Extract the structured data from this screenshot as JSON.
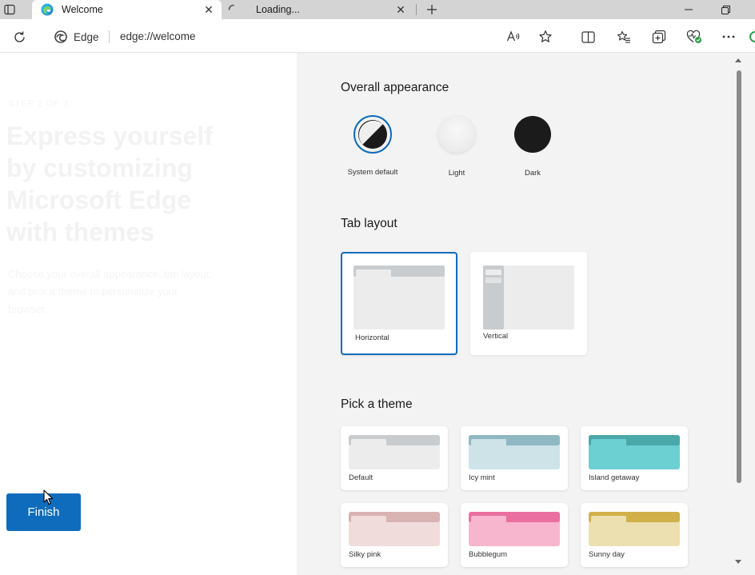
{
  "browser": {
    "tabs": [
      {
        "title": "Welcome",
        "active": true,
        "icon": "edge-logo-icon"
      },
      {
        "title": "Loading...",
        "active": false,
        "icon": "loading-spinner-icon"
      }
    ],
    "address": {
      "site_label": "Edge",
      "url": "edge://welcome"
    }
  },
  "welcome": {
    "kicker": "STEP 2 OF 3",
    "heading": "Express yourself by customizing Microsoft Edge with themes",
    "body": "Choose your overall appearance, tab layout, and pick a theme to personalize your browser.",
    "finish_label": "Finish"
  },
  "settings": {
    "appearance": {
      "title": "Overall appearance",
      "options": [
        {
          "label": "System default",
          "selected": true
        },
        {
          "label": "Light",
          "selected": false
        },
        {
          "label": "Dark",
          "selected": false
        }
      ]
    },
    "tab_layout": {
      "title": "Tab layout",
      "options": [
        {
          "label": "Horizontal",
          "selected": true
        },
        {
          "label": "Vertical",
          "selected": false
        }
      ]
    },
    "themes": {
      "title": "Pick a theme",
      "options": [
        {
          "label": "Default",
          "top_color": "#c9ccce",
          "body_color": "#ececec"
        },
        {
          "label": "Icy mint",
          "top_color": "#8fb8c2",
          "body_color": "#cde3e8"
        },
        {
          "label": "Island getaway",
          "top_color": "#4aa8a8",
          "body_color": "#6ccfd2"
        },
        {
          "label": "Silky pink",
          "top_color": "#d9b2b2",
          "body_color": "#f1dcdc"
        },
        {
          "label": "Bubblegum",
          "top_color": "#ea6f9f",
          "body_color": "#f7b6cd"
        },
        {
          "label": "Sunny day",
          "top_color": "#d1b04a",
          "body_color": "#ece0b0"
        }
      ]
    }
  },
  "colors": {
    "accent": "#0f6cbd",
    "right_pane_bg": "#f3f3f3",
    "tabstrip_bg": "#d4d4d4"
  }
}
